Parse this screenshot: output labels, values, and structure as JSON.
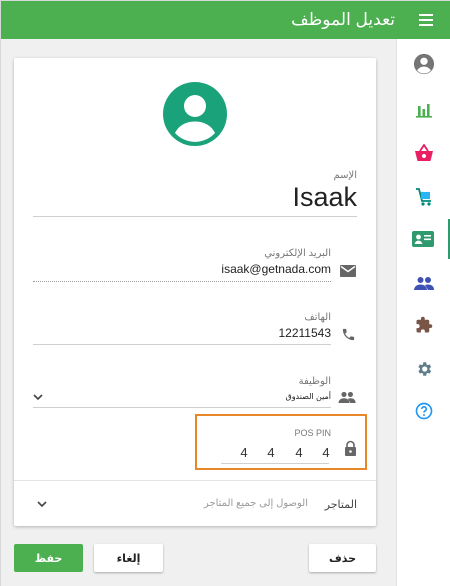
{
  "header": {
    "title": "تعديل الموظف",
    "menu_icon": "menu-icon"
  },
  "sidebar": {
    "items": [
      {
        "name": "account-icon",
        "color": "#757575",
        "active": false
      },
      {
        "name": "bar-chart-icon",
        "color": "#4caf50",
        "active": false
      },
      {
        "name": "basket-icon",
        "color": "#e91e63",
        "active": false
      },
      {
        "name": "cart-icon",
        "color": "#00897b",
        "active": false
      },
      {
        "name": "employee-card-icon",
        "color": "#2e9a6e",
        "active": true
      },
      {
        "name": "people-icon",
        "color": "#3f51b5",
        "active": false
      },
      {
        "name": "puzzle-icon",
        "color": "#795548",
        "active": false
      },
      {
        "name": "gear-icon",
        "color": "#607d8b",
        "active": false
      },
      {
        "name": "help-icon",
        "color": "#2196f3",
        "active": false
      }
    ]
  },
  "form": {
    "name_label": "الإسم",
    "name_value": "Isaak",
    "email_label": "البريد الإلكتروني",
    "email_value": "isaak@getnada.com",
    "phone_label": "الهاتف",
    "phone_value": "12211543",
    "job_label": "الوظيفة",
    "job_value": "أمين الصندوق",
    "pin_label": "POS PIN",
    "pin_digits": [
      "4",
      "4",
      "4",
      "4"
    ],
    "stores_label": "المتاجر",
    "stores_value": "الوصول إلى جميع المتاجر"
  },
  "buttons": {
    "save": "حفظ",
    "cancel": "إلغاء",
    "delete": "حذف"
  },
  "colors": {
    "primary": "#4caf50",
    "avatar": "#1aa37a",
    "highlight": "#e8862a"
  }
}
